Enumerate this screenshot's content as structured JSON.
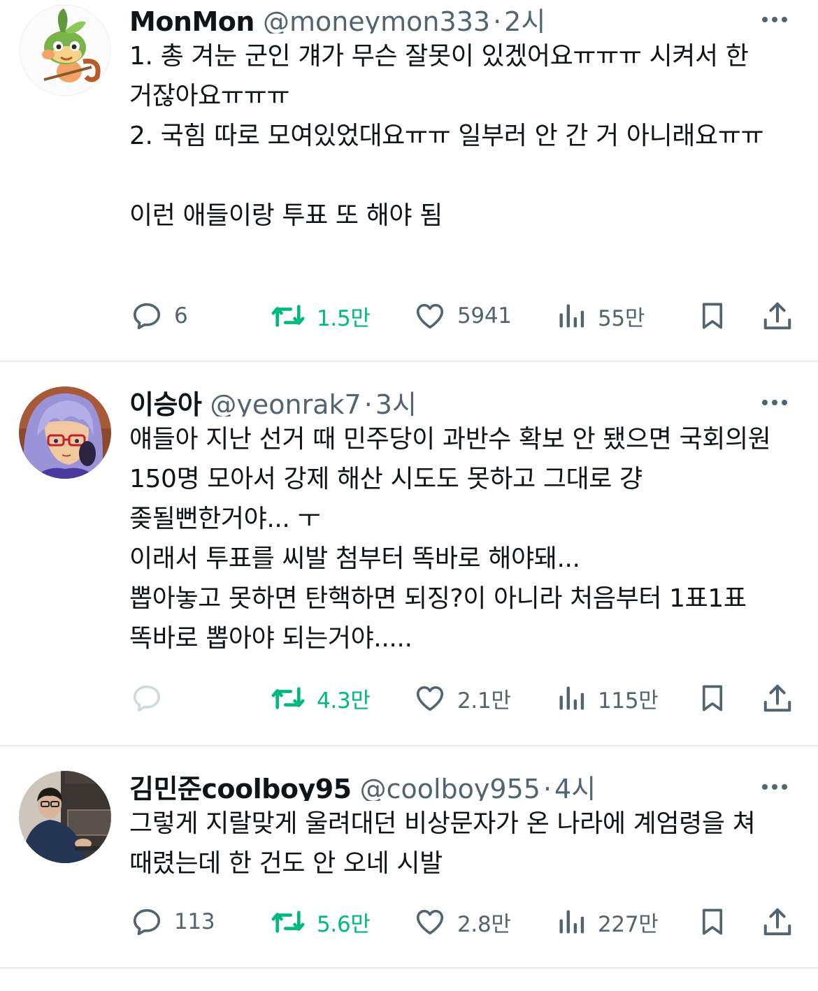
{
  "colors": {
    "text": "#0f1419",
    "secondary": "#536471",
    "retweet_green": "#00ba7c",
    "divider": "#e7e9eb"
  },
  "tweets": [
    {
      "name": "MonMon",
      "handle": "@moneymon333",
      "separator": "·",
      "time": "2시",
      "text": "1. 총 겨눈 군인 걔가 무슨 잘못이 있겠어요ㅠㅠㅠ 시켜서 한 거잖아요ㅠㅠㅠ\n2. 국힘 따로 모여있었대요ㅠㅠ 일부러 안 간 거 아니래요ㅠㅠ\n\n이런 애들이랑 투표 또 해야 됨",
      "replies": "6",
      "retweets": "1.5만",
      "likes": "5941",
      "views": "55만",
      "avatar_icon": "grookey-avatar"
    },
    {
      "name": "이승아",
      "handle": "@yeonrak7",
      "separator": "·",
      "time": "3시",
      "text": "얘들아 지난 선거 때 민주당이 과반수 확보 안 됐으면 국회의원 150명 모아서 강제 해산 시도도 못하고 그대로 걍 좆될뻔한거야... ㅜ\n이래서 투표를 씨발 첨부터 똑바로 해야돼...\n뽑아놓고 못하면 탄핵하면 되징?이 아니라 처음부터 1표1표 똑바로 뽑아야 되는거야.....",
      "replies": "",
      "retweets": "4.3만",
      "likes": "2.1만",
      "views": "115만",
      "avatar_icon": "anime-girl-avatar"
    },
    {
      "name": "김민준coolboy95",
      "handle": "@coolboy955",
      "separator": "·",
      "time": "4시",
      "text": "그렇게 지랄맞게 울려대던 비상문자가 온 나라에 계엄령을 쳐 때렸는데 한 건도 안 오네 시발",
      "replies": "113",
      "retweets": "5.6만",
      "likes": "2.8만",
      "views": "227만",
      "avatar_icon": "man-photo-avatar"
    }
  ]
}
